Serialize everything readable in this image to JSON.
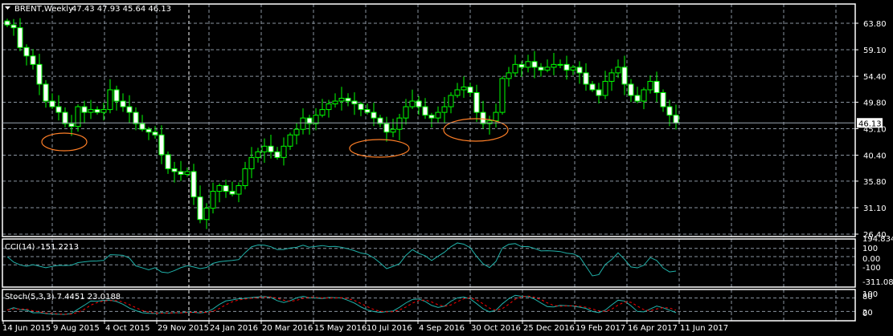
{
  "chart_data": {
    "type": "candlestick",
    "symbol": "BRENT,Weekly",
    "ohlc_label": "47.43 47.93 45.64 46.13",
    "last_price": "46.13",
    "price_ticks": [
      "63.80",
      "59.10",
      "54.40",
      "49.80",
      "45.10",
      "40.40",
      "35.80",
      "31.10",
      "26.40"
    ],
    "price_tick_values": [
      63.8,
      59.1,
      54.4,
      49.8,
      45.1,
      40.4,
      35.8,
      31.1,
      26.4
    ],
    "ylim": [
      26.4,
      63.8
    ],
    "time_labels": [
      "14 Jun 2015",
      "9 Aug 2015",
      "4 Oct 2015",
      "29 Nov 2015",
      "24 Jan 2016",
      "20 Mar 2016",
      "15 May 2016",
      "10 Jul 2016",
      "4 Sep 2016",
      "30 Oct 2016",
      "25 Dec 2016",
      "19 Feb 2017",
      "16 Apr 2017",
      "11 Jun 2017"
    ],
    "weekly_closes": [
      63.5,
      63.0,
      59.5,
      58,
      56.5,
      53,
      50,
      49,
      48,
      46,
      45.5,
      49,
      48,
      48.5,
      48,
      48.5,
      52,
      50,
      49,
      48,
      46,
      45,
      44.5,
      44,
      40.5,
      38,
      37.5,
      37,
      37.5,
      33,
      29,
      31,
      34,
      35,
      34,
      33.5,
      35,
      38,
      40,
      41,
      42,
      41,
      40,
      42,
      44,
      45,
      47,
      46,
      47.5,
      48.5,
      49.5,
      50,
      50.5,
      50,
      49.5,
      48.5,
      48,
      47,
      46,
      44.5,
      45,
      47,
      49,
      50,
      49,
      47.5,
      47,
      48,
      49,
      51,
      52,
      52.5,
      51.5,
      48,
      46,
      46.5,
      48,
      54,
      55,
      56.5,
      56,
      57,
      56,
      55.5,
      56,
      56.5,
      56.5,
      55.5,
      56,
      55,
      53,
      52,
      51,
      53.5,
      55,
      56,
      53,
      51,
      50,
      52,
      53.5,
      51.5,
      49,
      47.5,
      46.13
    ],
    "first_open": 64.2,
    "annotations": [
      {
        "type": "ellipse",
        "near": "9 Aug 2015 low"
      },
      {
        "type": "ellipse",
        "near": "10 Jul 2016 low"
      },
      {
        "type": "ellipse",
        "near": "30 Oct 2016 low"
      }
    ],
    "indicators": {
      "cci": {
        "label": "CCI(14) -151.2213",
        "period": 14,
        "ticks": [
          "194.8343",
          "100",
          "0.00",
          "-100",
          "-311.082"
        ],
        "tick_values": [
          194.8343,
          100,
          0,
          -100,
          -311.082
        ],
        "ylim": [
          -311.082,
          194.8343
        ]
      },
      "stoch": {
        "label": "Stoch(5,3,3) 7.4451 23.0188",
        "ticks": [
          "100",
          "80",
          "20",
          "0"
        ],
        "tick_values": [
          100,
          80,
          20,
          0
        ],
        "ylim": [
          0,
          100
        ]
      }
    }
  },
  "colors": {
    "bg": "#000000",
    "grid": "#8a94a0",
    "candle": "#00ff00",
    "bull_body": "#000000",
    "bear_body": "#ffffff",
    "cci": "#20b2aa",
    "stoch_main": "#20b2aa",
    "stoch_signal": "#ff0000",
    "ellipse": "#ff7f27"
  }
}
